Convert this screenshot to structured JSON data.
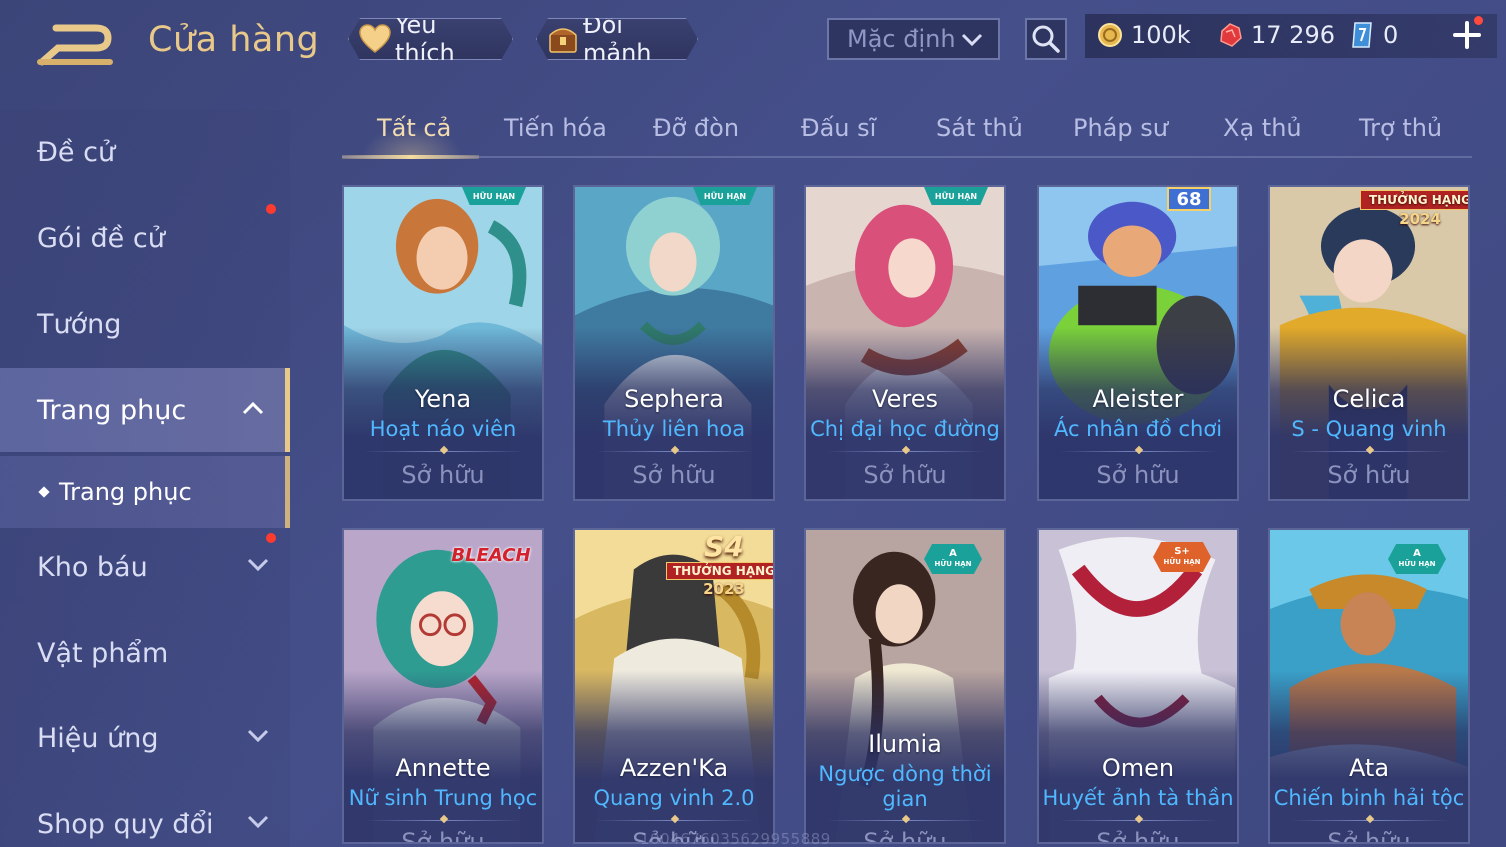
{
  "header": {
    "title": "Cửa hàng",
    "favorite_label": "Yêu thích",
    "exchange_label": "Đổi mảnh",
    "sort_value": "Mặc định",
    "currencies": {
      "gold": "100k",
      "ruby": "17 296",
      "voucher": "0"
    }
  },
  "sidebar": {
    "items": [
      {
        "label": "Đề cử"
      },
      {
        "label": "Gói đề cử"
      },
      {
        "label": "Tướng"
      },
      {
        "label": "Trang phục"
      },
      {
        "label": "Kho báu"
      },
      {
        "label": "Vật phẩm"
      },
      {
        "label": "Hiệu ứng"
      },
      {
        "label": "Shop quy đổi"
      }
    ],
    "sub_item": "Trang phục"
  },
  "tabs": [
    {
      "label": "Tất cả"
    },
    {
      "label": "Tiến hóa"
    },
    {
      "label": "Đỡ đòn"
    },
    {
      "label": "Đấu sĩ"
    },
    {
      "label": "Sát thủ"
    },
    {
      "label": "Pháp sư"
    },
    {
      "label": "Xạ thủ"
    },
    {
      "label": "Trợ thủ"
    }
  ],
  "cards": [
    {
      "hero": "Yena",
      "skin": "Hoạt náo viên",
      "status": "Sở hữu",
      "badge": "HỮU HẠN"
    },
    {
      "hero": "Sephera",
      "skin": "Thủy liên hoa",
      "status": "Sở hữu",
      "badge": "HỮU HẠN"
    },
    {
      "hero": "Veres",
      "skin": "Chị đại học đường",
      "status": "Sở hữu",
      "badge": "HỮU HẠN"
    },
    {
      "hero": "Aleister",
      "skin": "Ác nhân đồ chơi",
      "status": "Sở hữu",
      "badge": "68"
    },
    {
      "hero": "Celica",
      "skin": "S - Quang vinh",
      "status": "Sở hữu",
      "badge": "THƯỞNG HẠNG",
      "badge2": "2024"
    },
    {
      "hero": "Annette",
      "skin": "Nữ sinh Trung học",
      "status": "Sở hữu",
      "badge": "BLEACH"
    },
    {
      "hero": "Azzen'Ka",
      "skin": "Quang vinh 2.0",
      "status": "Sở hữu",
      "badge": "S4",
      "badge_rank": "THƯỞNG HẠNG",
      "badge_year": "2023"
    },
    {
      "hero": "Ilumia",
      "skin": "Ngược dòng thời gian",
      "status": "Sở hữu",
      "grade": "A",
      "badge": "HỮU HẠN"
    },
    {
      "hero": "Omen",
      "skin": "Huyết ảnh tà thần",
      "status": "Sở hữu",
      "grade": "S+",
      "badge": "HỮU HẠN"
    },
    {
      "hero": "Ata",
      "skin": "Chiến binh hải tộc",
      "status": "Sở hữu",
      "grade": "A",
      "badge": "HỮU HẠN"
    }
  ],
  "watermark": "1004676035629955889",
  "colors": {
    "accent": "#e8c98a",
    "skin_name": "#4fb8ff",
    "notification": "#ff3b30",
    "limited_badge": "#1aa29a"
  }
}
